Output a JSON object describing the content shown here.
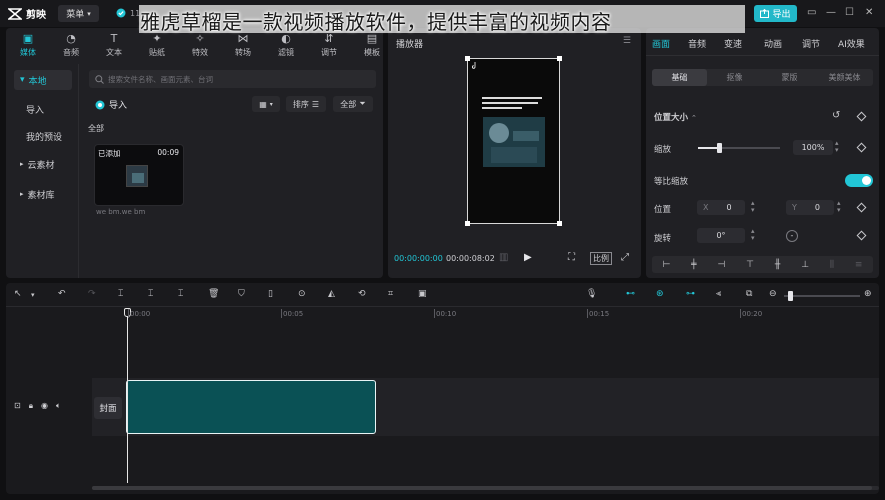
{
  "app": {
    "name": "剪映",
    "menu_label": "菜单",
    "autosave_text": "11",
    "export_label": "导出",
    "banner_text": "雅虎草榴是一款视频播放软件，提供丰富的视频内容",
    "accent": "#22c6d6"
  },
  "media_tabs": [
    {
      "label": "媒体",
      "icon": "media-icon"
    },
    {
      "label": "音频",
      "icon": "audio-icon"
    },
    {
      "label": "文本",
      "icon": "text-icon"
    },
    {
      "label": "贴纸",
      "icon": "sticker-icon"
    },
    {
      "label": "特效",
      "icon": "effects-icon"
    },
    {
      "label": "转场",
      "icon": "transition-icon"
    },
    {
      "label": "滤镜",
      "icon": "filter-icon"
    },
    {
      "label": "调节",
      "icon": "adjust-icon"
    },
    {
      "label": "模板",
      "icon": "template-icon"
    }
  ],
  "left_nav": {
    "local": "本地",
    "import": "导入",
    "presets": "我的预设",
    "cloud": "云素材",
    "library": "素材库"
  },
  "media": {
    "search_placeholder": "搜索文件名称、画面元素、台词",
    "import_label": "导入",
    "sort_label": "排序",
    "all_label": "全部",
    "section_all": "全部",
    "thumb_badge": "已添加",
    "thumb_duration": "00:09",
    "thumb_filename": "we bm.we bm"
  },
  "player": {
    "title": "播放器",
    "time_current": "00:00:00:00",
    "time_total": "00:00:08:02",
    "ratio_label": "比例"
  },
  "props": {
    "tabs": [
      "画面",
      "音频",
      "变速",
      "动画",
      "调节",
      "AI效果"
    ],
    "subtabs": [
      "基础",
      "抠像",
      "蒙版",
      "美颜美体"
    ],
    "position_size": "位置大小",
    "scale_label": "缩放",
    "scale_value": "100%",
    "uniform_label": "等比缩放",
    "position_label": "位置",
    "x_label": "X",
    "x_value": "0",
    "y_label": "Y",
    "y_value": "0",
    "rotate_label": "旋转",
    "rotate_value": "0°",
    "scale_fraction": 0.25
  },
  "timeline": {
    "ticks": [
      "00:00",
      "00:05",
      "00:10",
      "00:15",
      "00:20"
    ],
    "cover_label": "封面",
    "clip_color": "#0a5155"
  }
}
